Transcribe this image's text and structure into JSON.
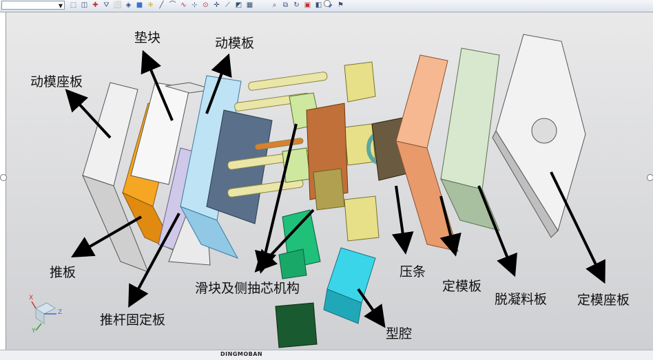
{
  "toolbar": {
    "combo_value": "",
    "icons": [
      "select-icon",
      "layer-icon",
      "snap-icon",
      "filter-icon",
      "box-select-icon",
      "view-icon",
      "shade-icon",
      "grid-icon",
      "line-icon",
      "arc-icon",
      "curve-icon",
      "point-icon",
      "circle-icon",
      "plus-icon",
      "slash-icon",
      "measure-icon",
      "table-icon",
      "zoom-icon",
      "copy-icon",
      "refresh-icon",
      "window-icon",
      "render-icon",
      "cube-icon",
      "flag-icon"
    ]
  },
  "labels": {
    "dianzuai": "垫块",
    "dongmoban": "动模板",
    "dongmozuoban": "动模座板",
    "tuiban": "推板",
    "tuiganguding": "推杆固定板",
    "huakuai": "滑块及侧抽芯机构",
    "xingqiang": "型腔",
    "yatiao": "压条",
    "dingmoban": "定模板",
    "tuoningliao": "脱凝料板",
    "dingmozuoban": "定模座板"
  },
  "triad": {
    "x": "X",
    "y": "Y",
    "z": "Z"
  },
  "status": {
    "name": "DINGMOBAN"
  }
}
